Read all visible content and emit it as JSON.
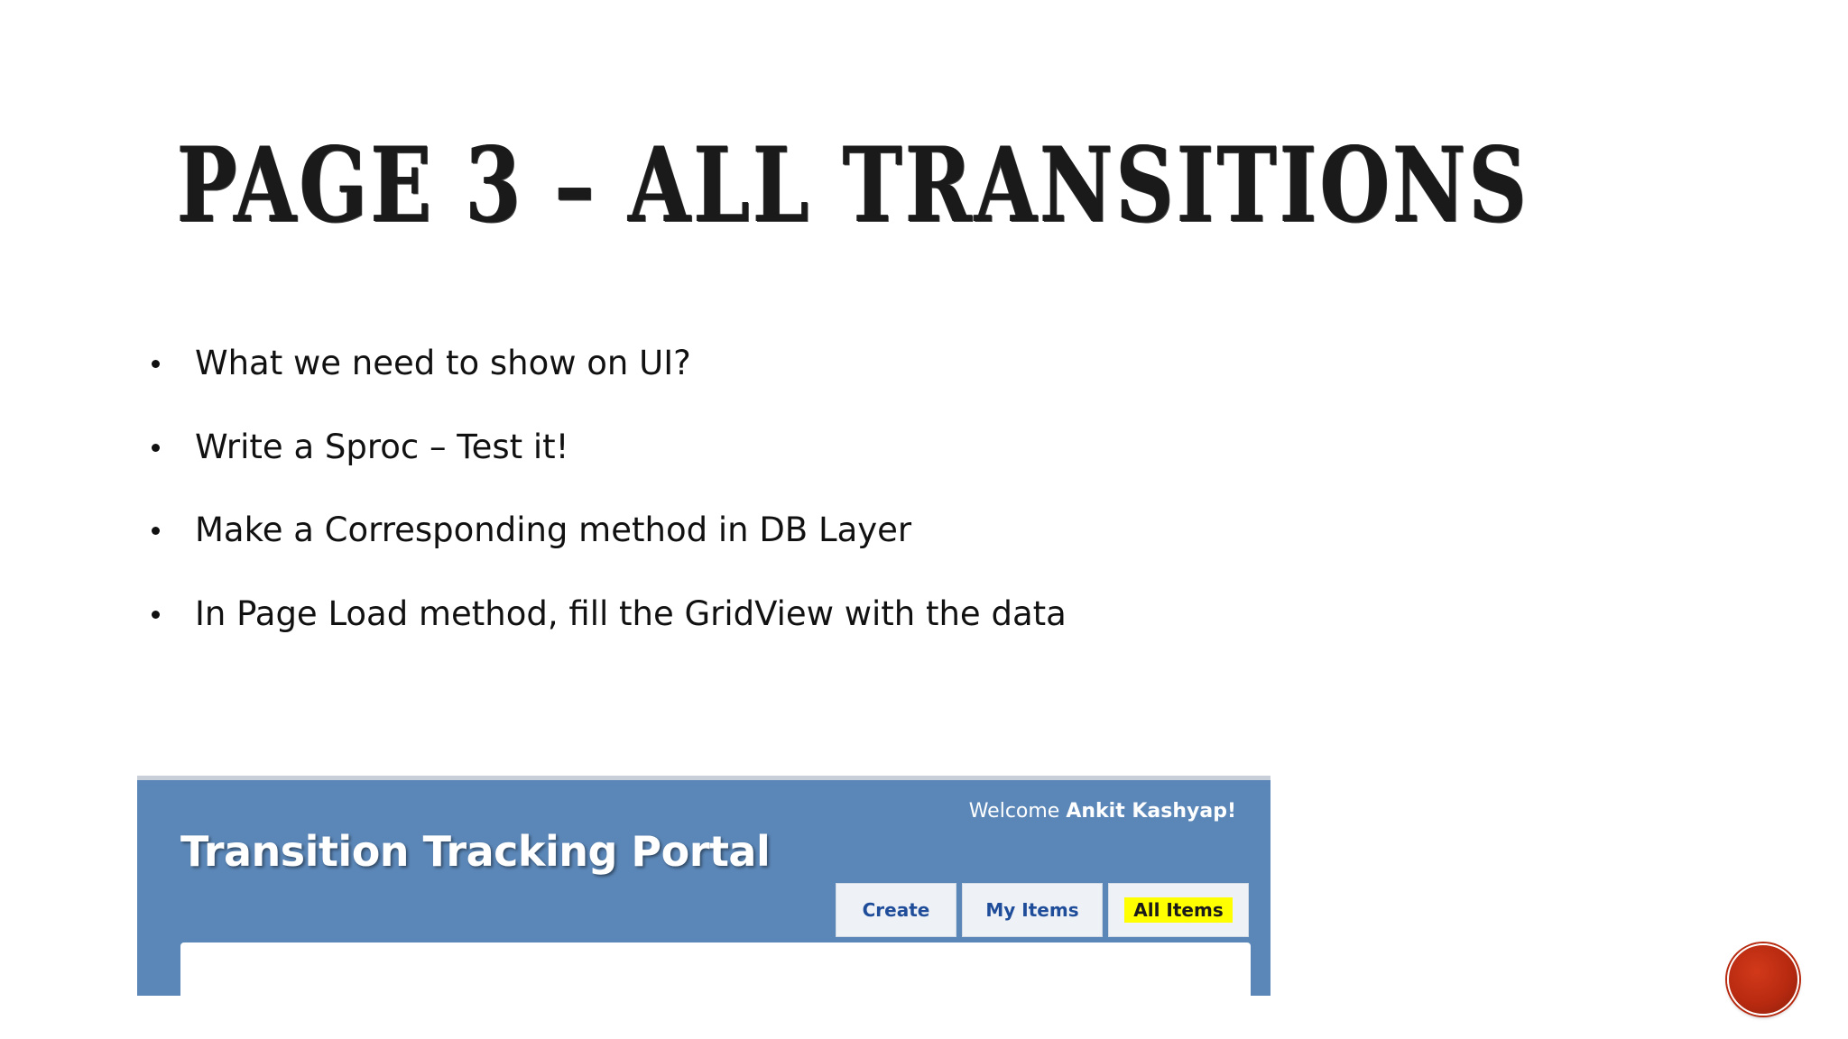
{
  "slide": {
    "title": "PAGE 3 – ALL TRANSITIONS",
    "bullets": [
      "What we need to show on UI?",
      "Write a Sproc – Test it!",
      "Make a Corresponding method in DB Layer",
      "In Page Load method, fill the GridView with the data"
    ]
  },
  "portal": {
    "title": "Transition Tracking Portal",
    "welcome_prefix": "Welcome ",
    "welcome_user": "Ankit Kashyap!",
    "tabs": [
      {
        "label": "Create"
      },
      {
        "label": "My Items"
      },
      {
        "label": "All Items",
        "highlighted": true
      }
    ],
    "colors": {
      "header_bg": "#5b87b8",
      "tab_text": "#1f4d9a",
      "highlight": "#ffff00"
    }
  },
  "decoration": {
    "icon": "red-circle-icon",
    "color": "#b82a10"
  }
}
